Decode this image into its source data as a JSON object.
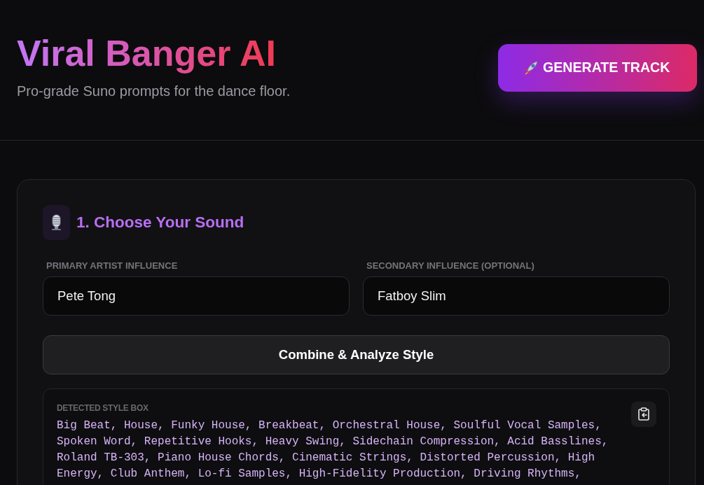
{
  "header": {
    "title": "Viral Banger AI",
    "subtitle": "Pro-grade Suno prompts for the dance floor.",
    "generate_button": {
      "label": "GENERATE TRACK"
    }
  },
  "section": {
    "title": "1. Choose Your Sound",
    "fields": [
      {
        "label": "PRIMARY ARTIST INFLUENCE",
        "value": "Pete Tong"
      },
      {
        "label": "SECONDARY INFLUENCE (OPTIONAL)",
        "value": "Fatboy Slim"
      }
    ],
    "analyze_button": {
      "label": "Combine & Analyze Style"
    },
    "style_box": {
      "label": "DETECTED STYLE BOX",
      "text": "Big Beat, House, Funky House, Breakbeat, Orchestral House, Soulful Vocal Samples, Spoken Word, Repetitive Hooks, Heavy Swing, Sidechain Compression, Acid Basslines, Roland TB-303, Piano House Chords, Cinematic Strings, Distorted Percussion, High Energy, Club Anthem, Lo-fi Samples, High-Fidelity Production, Driving Rhythms,"
    }
  }
}
